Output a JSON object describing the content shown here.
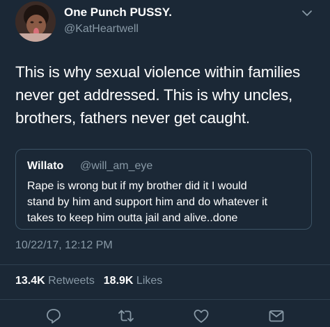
{
  "author": {
    "display_name": "One Punch PUSSY.",
    "handle": "@KatHeartwell"
  },
  "tweet": {
    "lines": [
      "This is why sexual violence within families",
      "never get addressed. This is why uncles,",
      "brothers, fathers never get caught."
    ]
  },
  "quoted_tweet": {
    "display_name": "Willato",
    "handle": "@will_am_eye",
    "lines": [
      "Rape is wrong but if my brother did it I would",
      "stand by him and support him and do whatever it",
      "takes to keep him outta jail and alive..done"
    ]
  },
  "timestamp": "10/22/17, 12:12 PM",
  "stats": {
    "retweets_count": "13.4K",
    "retweets_label": "Retweets",
    "likes_count": "18.9K",
    "likes_label": "Likes"
  },
  "icons": {
    "menu": "chevron-down-icon",
    "reply": "reply-icon",
    "retweet": "retweet-icon",
    "like": "heart-icon",
    "dm": "envelope-icon"
  },
  "colors": {
    "background": "#1b2836",
    "secondary_text": "#8899a6",
    "border": "#3d5466"
  }
}
